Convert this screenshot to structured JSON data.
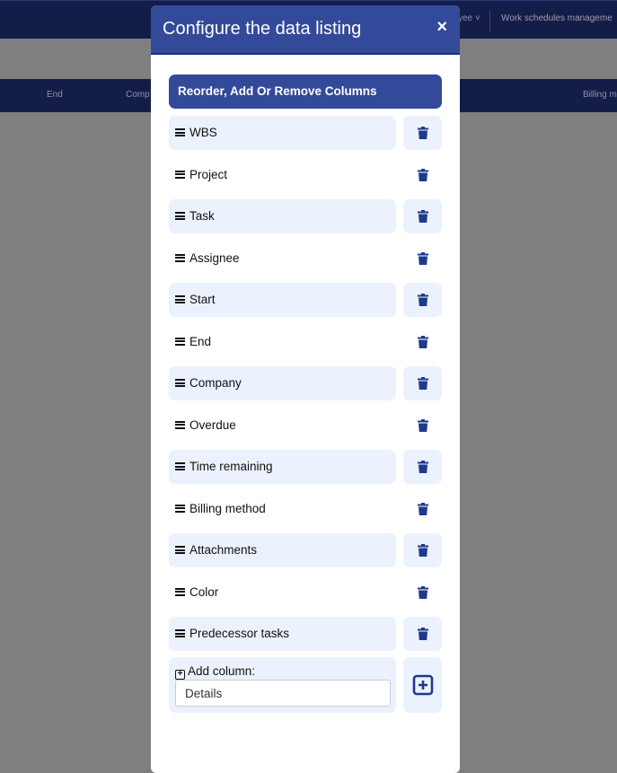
{
  "background": {
    "nav_items": [
      "yee",
      "Work schedules manageme"
    ],
    "column_headers": [
      "End",
      "Comp",
      "Billing m"
    ]
  },
  "modal": {
    "title": "Configure the data listing",
    "close_label": "×",
    "section_title": "Reorder, Add Or Remove Columns",
    "columns": [
      "WBS",
      "Project",
      "Task",
      "Assignee",
      "Start",
      "End",
      "Company",
      "Overdue",
      "Time remaining",
      "Billing method",
      "Attachments",
      "Color",
      "Predecessor tasks"
    ],
    "add_column": {
      "label": "Add column:",
      "value": "Details"
    }
  },
  "colors": {
    "accent": "#334a9a",
    "row_shade": "#ebf1fd",
    "icon": "#1e3a8a"
  }
}
